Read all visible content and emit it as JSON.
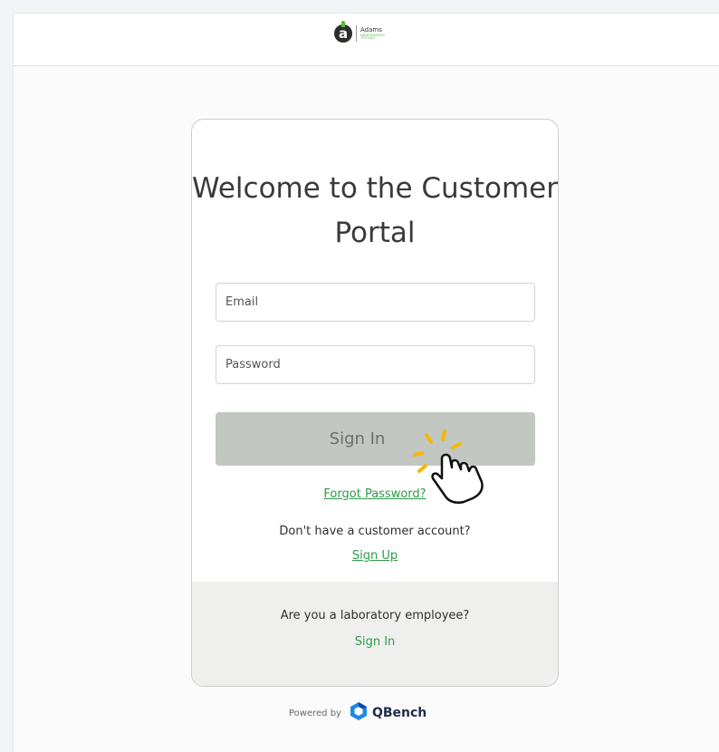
{
  "header": {
    "logo": {
      "mark": "a",
      "name": "Adams",
      "subtitle": "INDEPENDENT\nTESTING"
    }
  },
  "card": {
    "title": "Welcome to the Customer Portal",
    "email_placeholder": "Email",
    "password_placeholder": "Password",
    "signin_label": "Sign In",
    "forgot_label": "Forgot Password?",
    "no_account_text": "Don't have a customer account?",
    "signup_label": "Sign Up",
    "lab_question": "Are you a laboratory employee?",
    "lab_signin_label": "Sign In"
  },
  "footer": {
    "powered_by": "Powered by",
    "brand": "QBench"
  },
  "colors": {
    "accent_green": "#2d9a47",
    "button_gray": "#c3c7c1",
    "highlight_yellow": "#f5b800"
  },
  "overlay": {
    "cursor_icon": "hand-pointer-click-icon"
  }
}
